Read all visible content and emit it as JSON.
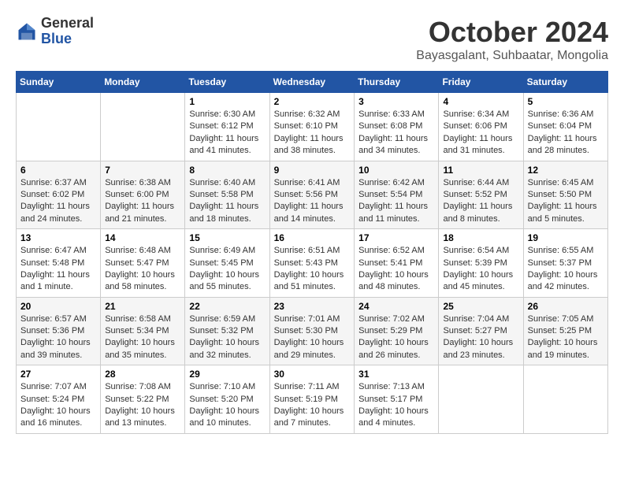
{
  "header": {
    "logo_general": "General",
    "logo_blue": "Blue",
    "month": "October 2024",
    "location": "Bayasgalant, Suhbaatar, Mongolia"
  },
  "calendar": {
    "days_of_week": [
      "Sunday",
      "Monday",
      "Tuesday",
      "Wednesday",
      "Thursday",
      "Friday",
      "Saturday"
    ],
    "weeks": [
      [
        {
          "day": "",
          "info": ""
        },
        {
          "day": "",
          "info": ""
        },
        {
          "day": "1",
          "info": "Sunrise: 6:30 AM\nSunset: 6:12 PM\nDaylight: 11 hours and 41 minutes."
        },
        {
          "day": "2",
          "info": "Sunrise: 6:32 AM\nSunset: 6:10 PM\nDaylight: 11 hours and 38 minutes."
        },
        {
          "day": "3",
          "info": "Sunrise: 6:33 AM\nSunset: 6:08 PM\nDaylight: 11 hours and 34 minutes."
        },
        {
          "day": "4",
          "info": "Sunrise: 6:34 AM\nSunset: 6:06 PM\nDaylight: 11 hours and 31 minutes."
        },
        {
          "day": "5",
          "info": "Sunrise: 6:36 AM\nSunset: 6:04 PM\nDaylight: 11 hours and 28 minutes."
        }
      ],
      [
        {
          "day": "6",
          "info": "Sunrise: 6:37 AM\nSunset: 6:02 PM\nDaylight: 11 hours and 24 minutes."
        },
        {
          "day": "7",
          "info": "Sunrise: 6:38 AM\nSunset: 6:00 PM\nDaylight: 11 hours and 21 minutes."
        },
        {
          "day": "8",
          "info": "Sunrise: 6:40 AM\nSunset: 5:58 PM\nDaylight: 11 hours and 18 minutes."
        },
        {
          "day": "9",
          "info": "Sunrise: 6:41 AM\nSunset: 5:56 PM\nDaylight: 11 hours and 14 minutes."
        },
        {
          "day": "10",
          "info": "Sunrise: 6:42 AM\nSunset: 5:54 PM\nDaylight: 11 hours and 11 minutes."
        },
        {
          "day": "11",
          "info": "Sunrise: 6:44 AM\nSunset: 5:52 PM\nDaylight: 11 hours and 8 minutes."
        },
        {
          "day": "12",
          "info": "Sunrise: 6:45 AM\nSunset: 5:50 PM\nDaylight: 11 hours and 5 minutes."
        }
      ],
      [
        {
          "day": "13",
          "info": "Sunrise: 6:47 AM\nSunset: 5:48 PM\nDaylight: 11 hours and 1 minute."
        },
        {
          "day": "14",
          "info": "Sunrise: 6:48 AM\nSunset: 5:47 PM\nDaylight: 10 hours and 58 minutes."
        },
        {
          "day": "15",
          "info": "Sunrise: 6:49 AM\nSunset: 5:45 PM\nDaylight: 10 hours and 55 minutes."
        },
        {
          "day": "16",
          "info": "Sunrise: 6:51 AM\nSunset: 5:43 PM\nDaylight: 10 hours and 51 minutes."
        },
        {
          "day": "17",
          "info": "Sunrise: 6:52 AM\nSunset: 5:41 PM\nDaylight: 10 hours and 48 minutes."
        },
        {
          "day": "18",
          "info": "Sunrise: 6:54 AM\nSunset: 5:39 PM\nDaylight: 10 hours and 45 minutes."
        },
        {
          "day": "19",
          "info": "Sunrise: 6:55 AM\nSunset: 5:37 PM\nDaylight: 10 hours and 42 minutes."
        }
      ],
      [
        {
          "day": "20",
          "info": "Sunrise: 6:57 AM\nSunset: 5:36 PM\nDaylight: 10 hours and 39 minutes."
        },
        {
          "day": "21",
          "info": "Sunrise: 6:58 AM\nSunset: 5:34 PM\nDaylight: 10 hours and 35 minutes."
        },
        {
          "day": "22",
          "info": "Sunrise: 6:59 AM\nSunset: 5:32 PM\nDaylight: 10 hours and 32 minutes."
        },
        {
          "day": "23",
          "info": "Sunrise: 7:01 AM\nSunset: 5:30 PM\nDaylight: 10 hours and 29 minutes."
        },
        {
          "day": "24",
          "info": "Sunrise: 7:02 AM\nSunset: 5:29 PM\nDaylight: 10 hours and 26 minutes."
        },
        {
          "day": "25",
          "info": "Sunrise: 7:04 AM\nSunset: 5:27 PM\nDaylight: 10 hours and 23 minutes."
        },
        {
          "day": "26",
          "info": "Sunrise: 7:05 AM\nSunset: 5:25 PM\nDaylight: 10 hours and 19 minutes."
        }
      ],
      [
        {
          "day": "27",
          "info": "Sunrise: 7:07 AM\nSunset: 5:24 PM\nDaylight: 10 hours and 16 minutes."
        },
        {
          "day": "28",
          "info": "Sunrise: 7:08 AM\nSunset: 5:22 PM\nDaylight: 10 hours and 13 minutes."
        },
        {
          "day": "29",
          "info": "Sunrise: 7:10 AM\nSunset: 5:20 PM\nDaylight: 10 hours and 10 minutes."
        },
        {
          "day": "30",
          "info": "Sunrise: 7:11 AM\nSunset: 5:19 PM\nDaylight: 10 hours and 7 minutes."
        },
        {
          "day": "31",
          "info": "Sunrise: 7:13 AM\nSunset: 5:17 PM\nDaylight: 10 hours and 4 minutes."
        },
        {
          "day": "",
          "info": ""
        },
        {
          "day": "",
          "info": ""
        }
      ]
    ]
  }
}
